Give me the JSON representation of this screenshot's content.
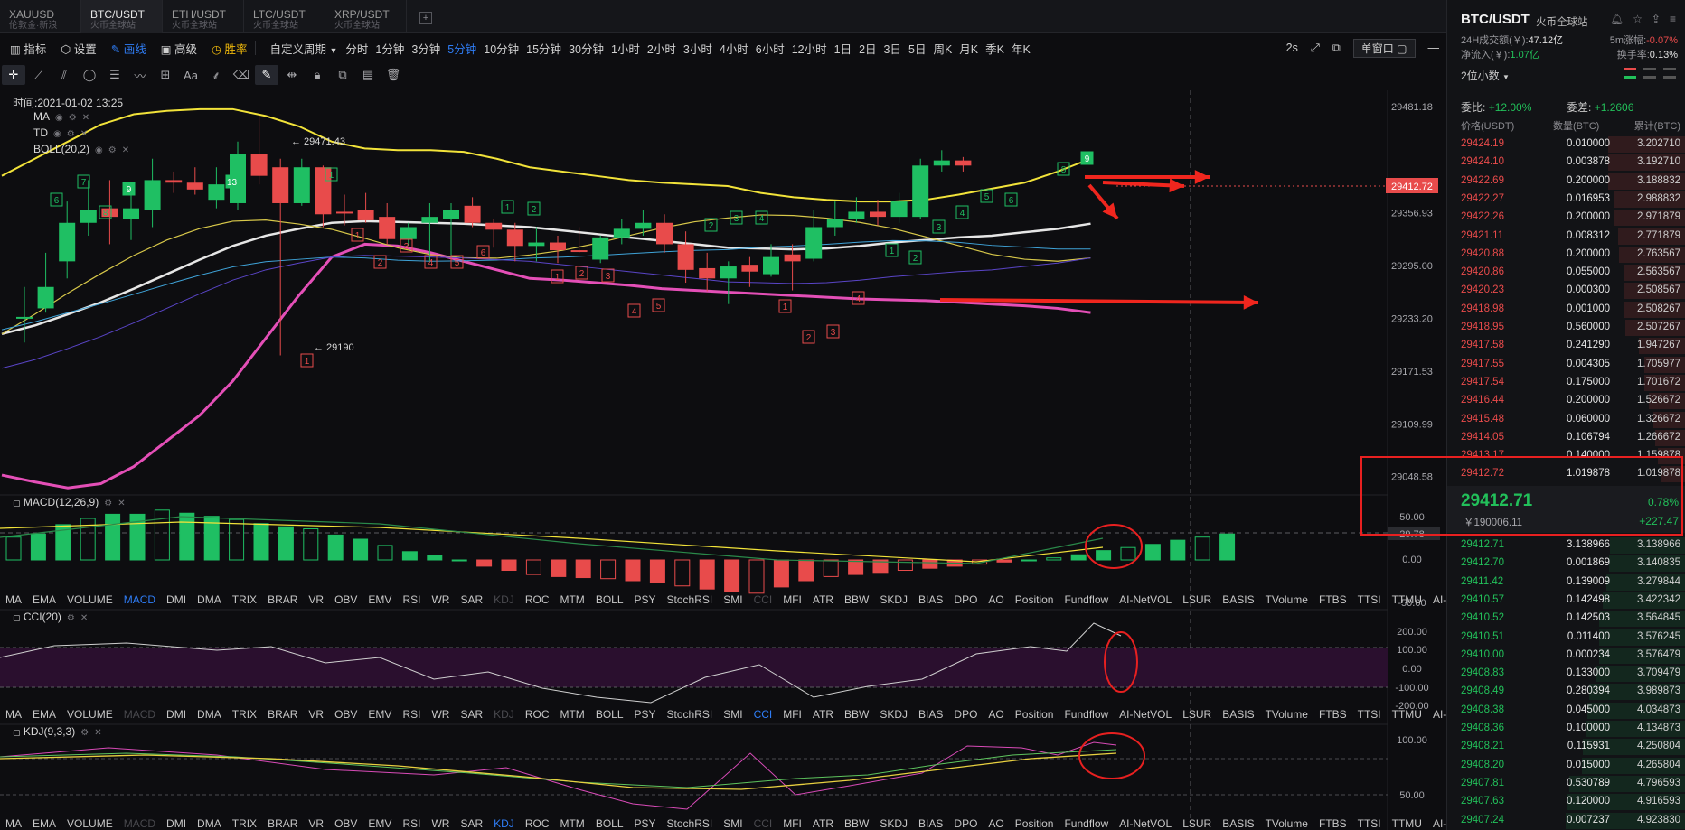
{
  "tabs": [
    {
      "symbol": "XAUUSD",
      "sub": "伦敦金·新浪"
    },
    {
      "symbol": "BTC/USDT",
      "sub": "火币全球站"
    },
    {
      "symbol": "ETH/USDT",
      "sub": "火币全球站"
    },
    {
      "symbol": "LTC/USDT",
      "sub": "火币全球站"
    },
    {
      "symbol": "XRP/USDT",
      "sub": "火币全球站"
    }
  ],
  "toolbar": {
    "indicators": "指标",
    "settings": "设置",
    "draw": "画线",
    "advanced": "高级",
    "winrate": "胜率",
    "custom_period": "自定义周期",
    "periods": [
      "分时",
      "1分钟",
      "3分钟",
      "5分钟",
      "10分钟",
      "15分钟",
      "30分钟",
      "1小时",
      "2小时",
      "3小时",
      "4小时",
      "6小时",
      "12小时",
      "1日",
      "2日",
      "3日",
      "5日",
      "周K",
      "月K",
      "季K",
      "年K"
    ],
    "interval": "2s",
    "window_mode": "单窗口"
  },
  "chart": {
    "time_label": "时间:2021-01-02 13:25",
    "legend": [
      "MA",
      "TD",
      "BOLL(20,2)"
    ],
    "high_label": "29471.43",
    "low_label": "29190",
    "current_price": "29412.72",
    "price_axis": [
      "29481.18",
      "29356.93",
      "29295.00",
      "29233.20",
      "29171.53",
      "29109.99",
      "29048.58"
    ],
    "macd": {
      "title": "MACD(12,26,9)",
      "axis": [
        "50.00",
        "29.78",
        "0.00",
        "-50.00"
      ]
    },
    "cci": {
      "title": "CCI(20)",
      "axis": [
        "200.00",
        "100.00",
        "0.00",
        "-100.00",
        "-200.00"
      ]
    },
    "kdj": {
      "title": "KDJ(9,3,3)",
      "axis": [
        "100.00",
        "50.00"
      ]
    },
    "indicator_names": [
      "MA",
      "EMA",
      "VOLUME",
      "MACD",
      "DMI",
      "DMA",
      "TRIX",
      "BRAR",
      "VR",
      "OBV",
      "EMV",
      "RSI",
      "WR",
      "SAR",
      "KDJ",
      "ROC",
      "MTM",
      "BOLL",
      "PSY",
      "StochRSI",
      "SMI",
      "CCI",
      "MFI",
      "ATR",
      "BBW",
      "SKDJ",
      "BIAS",
      "DPO",
      "AO",
      "Position",
      "Fundflow",
      "AI-NetVOL",
      "LSUR",
      "BASIS",
      "TVolume",
      "FTBS",
      "TTSI",
      "TTMU",
      "AI-BSI"
    ]
  },
  "chart_data": {
    "type": "candlestick",
    "time": "2021-01-02 13:25",
    "ylim": [
      29030,
      29500
    ],
    "candles": [
      {
        "o": 29234,
        "h": 29270,
        "l": 29205,
        "c": 29235
      },
      {
        "o": 29245,
        "h": 29310,
        "l": 29240,
        "c": 29270
      },
      {
        "o": 29300,
        "h": 29370,
        "l": 29280,
        "c": 29345
      },
      {
        "o": 29345,
        "h": 29395,
        "l": 29330,
        "c": 29360
      },
      {
        "o": 29362,
        "h": 29395,
        "l": 29320,
        "c": 29352
      },
      {
        "o": 29350,
        "h": 29385,
        "l": 29325,
        "c": 29362
      },
      {
        "o": 29360,
        "h": 29420,
        "l": 29340,
        "c": 29395
      },
      {
        "o": 29395,
        "h": 29405,
        "l": 29380,
        "c": 29392
      },
      {
        "o": 29392,
        "h": 29410,
        "l": 29378,
        "c": 29384
      },
      {
        "o": 29372,
        "h": 29410,
        "l": 29362,
        "c": 29390
      },
      {
        "o": 29368,
        "h": 29440,
        "l": 29360,
        "c": 29425
      },
      {
        "o": 29425,
        "h": 29471,
        "l": 29390,
        "c": 29400
      },
      {
        "o": 29410,
        "h": 29420,
        "l": 29190,
        "c": 29368
      },
      {
        "o": 29368,
        "h": 29420,
        "l": 29365,
        "c": 29410
      },
      {
        "o": 29410,
        "h": 29412,
        "l": 29340,
        "c": 29355
      },
      {
        "o": 29358,
        "h": 29378,
        "l": 29342,
        "c": 29356
      },
      {
        "o": 29360,
        "h": 29380,
        "l": 29345,
        "c": 29348
      },
      {
        "o": 29352,
        "h": 29368,
        "l": 29320,
        "c": 29326
      },
      {
        "o": 29326,
        "h": 29345,
        "l": 29318,
        "c": 29340
      },
      {
        "o": 29345,
        "h": 29368,
        "l": 29300,
        "c": 29352
      },
      {
        "o": 29350,
        "h": 29368,
        "l": 29300,
        "c": 29360
      },
      {
        "o": 29365,
        "h": 29375,
        "l": 29340,
        "c": 29345
      },
      {
        "o": 29345,
        "h": 29350,
        "l": 29316,
        "c": 29337
      },
      {
        "o": 29337,
        "h": 29345,
        "l": 29300,
        "c": 29318
      },
      {
        "o": 29318,
        "h": 29340,
        "l": 29300,
        "c": 29322
      },
      {
        "o": 29322,
        "h": 29330,
        "l": 29298,
        "c": 29313
      },
      {
        "o": 29313,
        "h": 29340,
        "l": 29310,
        "c": 29312
      },
      {
        "o": 29302,
        "h": 29330,
        "l": 29298,
        "c": 29328
      },
      {
        "o": 29328,
        "h": 29350,
        "l": 29320,
        "c": 29338
      },
      {
        "o": 29338,
        "h": 29360,
        "l": 29330,
        "c": 29345
      },
      {
        "o": 29345,
        "h": 29355,
        "l": 29310,
        "c": 29320
      },
      {
        "o": 29320,
        "h": 29335,
        "l": 29275,
        "c": 29290
      },
      {
        "o": 29292,
        "h": 29310,
        "l": 29265,
        "c": 29280
      },
      {
        "o": 29280,
        "h": 29300,
        "l": 29250,
        "c": 29294
      },
      {
        "o": 29296,
        "h": 29305,
        "l": 29270,
        "c": 29288
      },
      {
        "o": 29285,
        "h": 29320,
        "l": 29282,
        "c": 29305
      },
      {
        "o": 29308,
        "h": 29320,
        "l": 29266,
        "c": 29300
      },
      {
        "o": 29303,
        "h": 29360,
        "l": 29300,
        "c": 29340
      },
      {
        "o": 29340,
        "h": 29370,
        "l": 29330,
        "c": 29350
      },
      {
        "o": 29350,
        "h": 29375,
        "l": 29345,
        "c": 29358
      },
      {
        "o": 29358,
        "h": 29372,
        "l": 29342,
        "c": 29352
      },
      {
        "o": 29352,
        "h": 29380,
        "l": 29345,
        "c": 29370
      },
      {
        "o": 29352,
        "h": 29420,
        "l": 29350,
        "c": 29412
      },
      {
        "o": 29412,
        "h": 29430,
        "l": 29405,
        "c": 29418
      },
      {
        "o": 29418,
        "h": 29422,
        "l": 29405,
        "c": 29412
      }
    ],
    "boll_upper": [
      29400,
      29420,
      29440,
      29460,
      29472,
      29476,
      29478,
      29478,
      29470,
      29458,
      29440,
      29432,
      29430,
      29430,
      29428,
      29420,
      29410,
      29405,
      29400,
      29395,
      29392,
      29390,
      29388,
      29380,
      29375,
      29372,
      29370,
      29370,
      29372,
      29378,
      29385,
      29392,
      29405,
      29420
    ],
    "boll_mid": [
      29215,
      29225,
      29238,
      29252,
      29268,
      29285,
      29302,
      29318,
      29330,
      29338,
      29345,
      29347,
      29346,
      29345,
      29344,
      29342,
      29340,
      29336,
      29332,
      29328,
      29324,
      29320,
      29316,
      29315,
      29314,
      29315,
      29318,
      29322,
      29325,
      29328,
      29330,
      29334,
      29338,
      29344
    ],
    "boll_lower": [
      29050,
      29042,
      29035,
      29040,
      29060,
      29090,
      29120,
      29160,
      29210,
      29260,
      29305,
      29320,
      29318,
      29310,
      29300,
      29290,
      29280,
      29278,
      29275,
      29272,
      29268,
      29266,
      29264,
      29262,
      29260,
      29258,
      29256,
      29255,
      29254,
      29252,
      29250,
      29248,
      29245,
      29240
    ]
  },
  "panel": {
    "title": "BTC/USDT",
    "exchange": "火币全球站",
    "vol_label": "24H成交额(￥):",
    "vol_value": "47.12亿",
    "chg_label": "5m涨幅:",
    "chg_value": "-0.07%",
    "inflow_label": "净流入(￥):",
    "inflow_value": "1.07亿",
    "turnover_label": "换手率:",
    "turnover_value": "0.13%",
    "decimals": "2位小数",
    "weibi_label": "委比:",
    "weibi_value": "+12.00%",
    "weicha_label": "委差:",
    "weicha_value": "+1.2606",
    "col_price": "价格(USDT)",
    "col_qty": "数量(BTC)",
    "col_cum": "累计(BTC)",
    "asks": [
      [
        "29424.19",
        "0.010000",
        "3.202710"
      ],
      [
        "29424.10",
        "0.003878",
        "3.192710"
      ],
      [
        "29422.69",
        "0.200000",
        "3.188832"
      ],
      [
        "29422.27",
        "0.016953",
        "2.988832"
      ],
      [
        "29422.26",
        "0.200000",
        "2.971879"
      ],
      [
        "29421.11",
        "0.008312",
        "2.771879"
      ],
      [
        "29420.88",
        "0.200000",
        "2.763567"
      ],
      [
        "29420.86",
        "0.055000",
        "2.563567"
      ],
      [
        "29420.23",
        "0.000300",
        "2.508567"
      ],
      [
        "29418.98",
        "0.001000",
        "2.508267"
      ],
      [
        "29418.95",
        "0.560000",
        "2.507267"
      ],
      [
        "29417.58",
        "0.241290",
        "1.947267"
      ],
      [
        "29417.55",
        "0.004305",
        "1.705977"
      ],
      [
        "29417.54",
        "0.175000",
        "1.701672"
      ],
      [
        "29416.44",
        "0.200000",
        "1.526672"
      ],
      [
        "29415.48",
        "0.060000",
        "1.326672"
      ],
      [
        "29414.05",
        "0.106794",
        "1.266672"
      ],
      [
        "29413.17",
        "0.140000",
        "1.159878"
      ],
      [
        "29412.72",
        "1.019878",
        "1.019878"
      ]
    ],
    "last_price": "29412.71",
    "last_cny": "￥190006.11",
    "last_pct": "0.78%",
    "last_chg": "+227.47",
    "bids": [
      [
        "29412.71",
        "3.138966",
        "3.138966"
      ],
      [
        "29412.70",
        "0.001869",
        "3.140835"
      ],
      [
        "29411.42",
        "0.139009",
        "3.279844"
      ],
      [
        "29410.57",
        "0.142498",
        "3.422342"
      ],
      [
        "29410.52",
        "0.142503",
        "3.564845"
      ],
      [
        "29410.51",
        "0.011400",
        "3.576245"
      ],
      [
        "29410.00",
        "0.000234",
        "3.576479"
      ],
      [
        "29408.83",
        "0.133000",
        "3.709479"
      ],
      [
        "29408.49",
        "0.280394",
        "3.989873"
      ],
      [
        "29408.38",
        "0.045000",
        "4.034873"
      ],
      [
        "29408.36",
        "0.100000",
        "4.134873"
      ],
      [
        "29408.21",
        "0.115931",
        "4.250804"
      ],
      [
        "29408.20",
        "0.015000",
        "4.265804"
      ],
      [
        "29407.81",
        "0.530789",
        "4.796593"
      ],
      [
        "29407.63",
        "0.120000",
        "4.916593"
      ],
      [
        "29407.24",
        "0.007237",
        "4.923830"
      ]
    ]
  }
}
